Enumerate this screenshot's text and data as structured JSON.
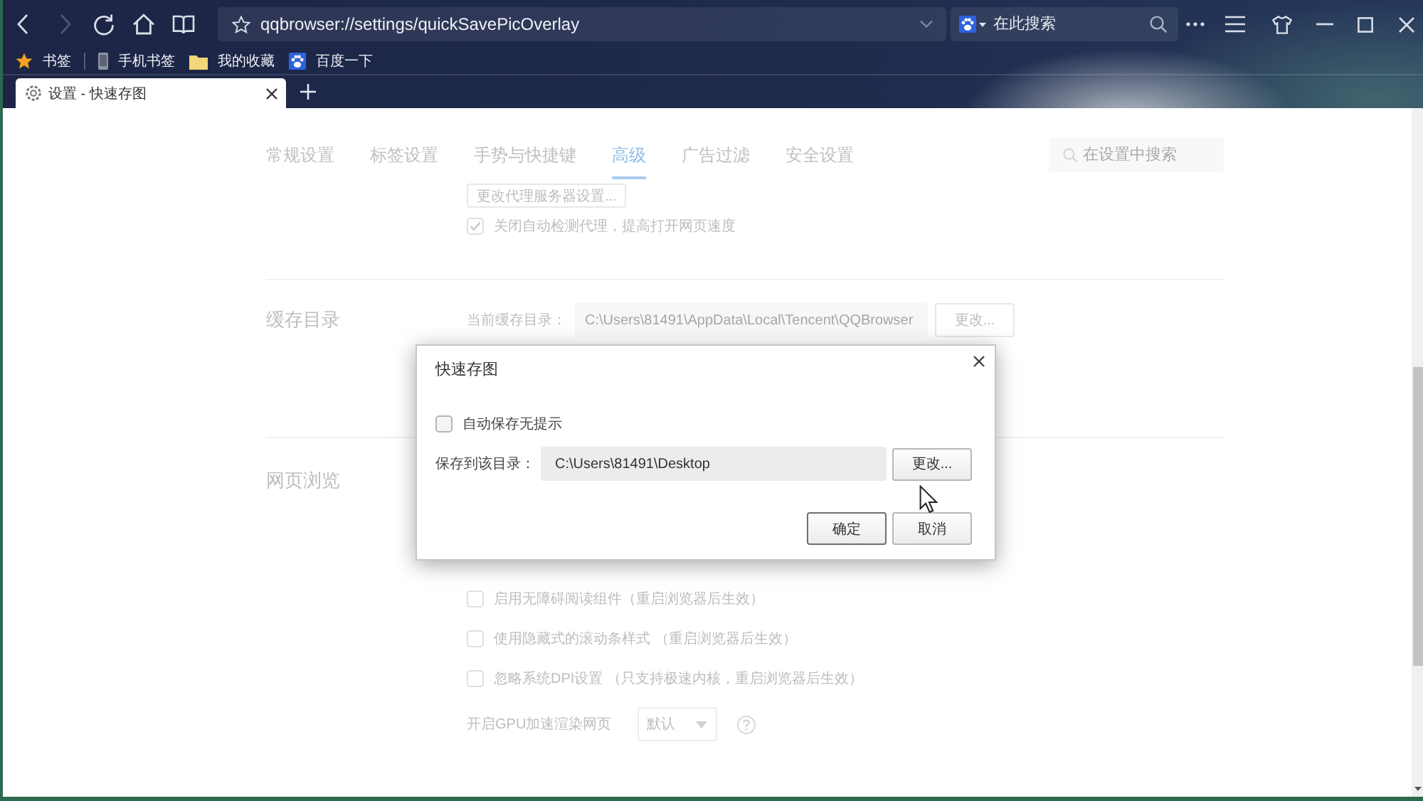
{
  "toolbar": {
    "nav_buttons": [
      {
        "kind": "back",
        "disabled": false
      },
      {
        "kind": "forward",
        "disabled": true
      },
      {
        "kind": "reload",
        "disabled": false
      },
      {
        "kind": "home",
        "disabled": false
      },
      {
        "kind": "reader",
        "disabled": false
      }
    ],
    "address_bar": {
      "url": "qqbrowser://settings/quickSavePicOverlay"
    },
    "search_box": {
      "placeholder": "在此搜索"
    }
  },
  "bookmarks": [
    {
      "kind": "star",
      "label": "书签"
    },
    {
      "kind": "phone",
      "label": "手机书签"
    },
    {
      "kind": "folder",
      "label": "我的收藏"
    },
    {
      "kind": "paw",
      "label": "百度一下"
    }
  ],
  "tabs": [
    {
      "label": "设置 - 快速存图",
      "selected": true
    }
  ],
  "settings": {
    "nav": [
      {
        "label": "常规设置",
        "selected": false
      },
      {
        "label": "标签设置",
        "selected": false
      },
      {
        "label": "手势与快捷键",
        "selected": false
      },
      {
        "label": "高级",
        "selected": true
      },
      {
        "label": "广告过滤",
        "selected": false
      },
      {
        "label": "安全设置",
        "selected": false
      }
    ],
    "search": {
      "placeholder": "在设置中搜索"
    },
    "sections": [
      {
        "items": [
          {
            "kind": "button",
            "label": "更改代理服务器设置..."
          },
          {
            "kind": "checkbox",
            "label": "关闭自动检测代理，提高打开网页速度",
            "checked": true
          }
        ]
      },
      {
        "title": "缓存目录",
        "items": [
          {
            "kind": "path",
            "label": "当前缓存目录：",
            "value": "C:\\Users\\81491\\AppData\\Local\\Tencent\\QQBrowser",
            "button": "更改..."
          }
        ]
      },
      {
        "title": "网页浏览",
        "items": [
          {
            "kind": "checkbox",
            "label": "启用无障碍阅读组件（重启浏览器后生效）",
            "checked": false
          },
          {
            "kind": "checkbox",
            "label": "使用隐藏式的滚动条样式 （重启浏览器后生效）",
            "checked": false
          },
          {
            "kind": "checkbox",
            "label": "忽略系统DPI设置 （只支持极速内核，重启浏览器后生效）",
            "checked": false
          },
          {
            "kind": "select",
            "label": "开启GPU加速渲染网页",
            "value": "默认"
          }
        ]
      }
    ]
  },
  "dialog": {
    "title": "快速存图",
    "auto_save": {
      "label": "自动保存无提示",
      "checked": false
    },
    "path": {
      "label": "保存到该目录：",
      "value": "C:\\Users\\81491\\Desktop",
      "button": "更改..."
    },
    "buttons": [
      {
        "label": "确定",
        "default": true
      },
      {
        "label": "取消",
        "default": false
      }
    ]
  }
}
